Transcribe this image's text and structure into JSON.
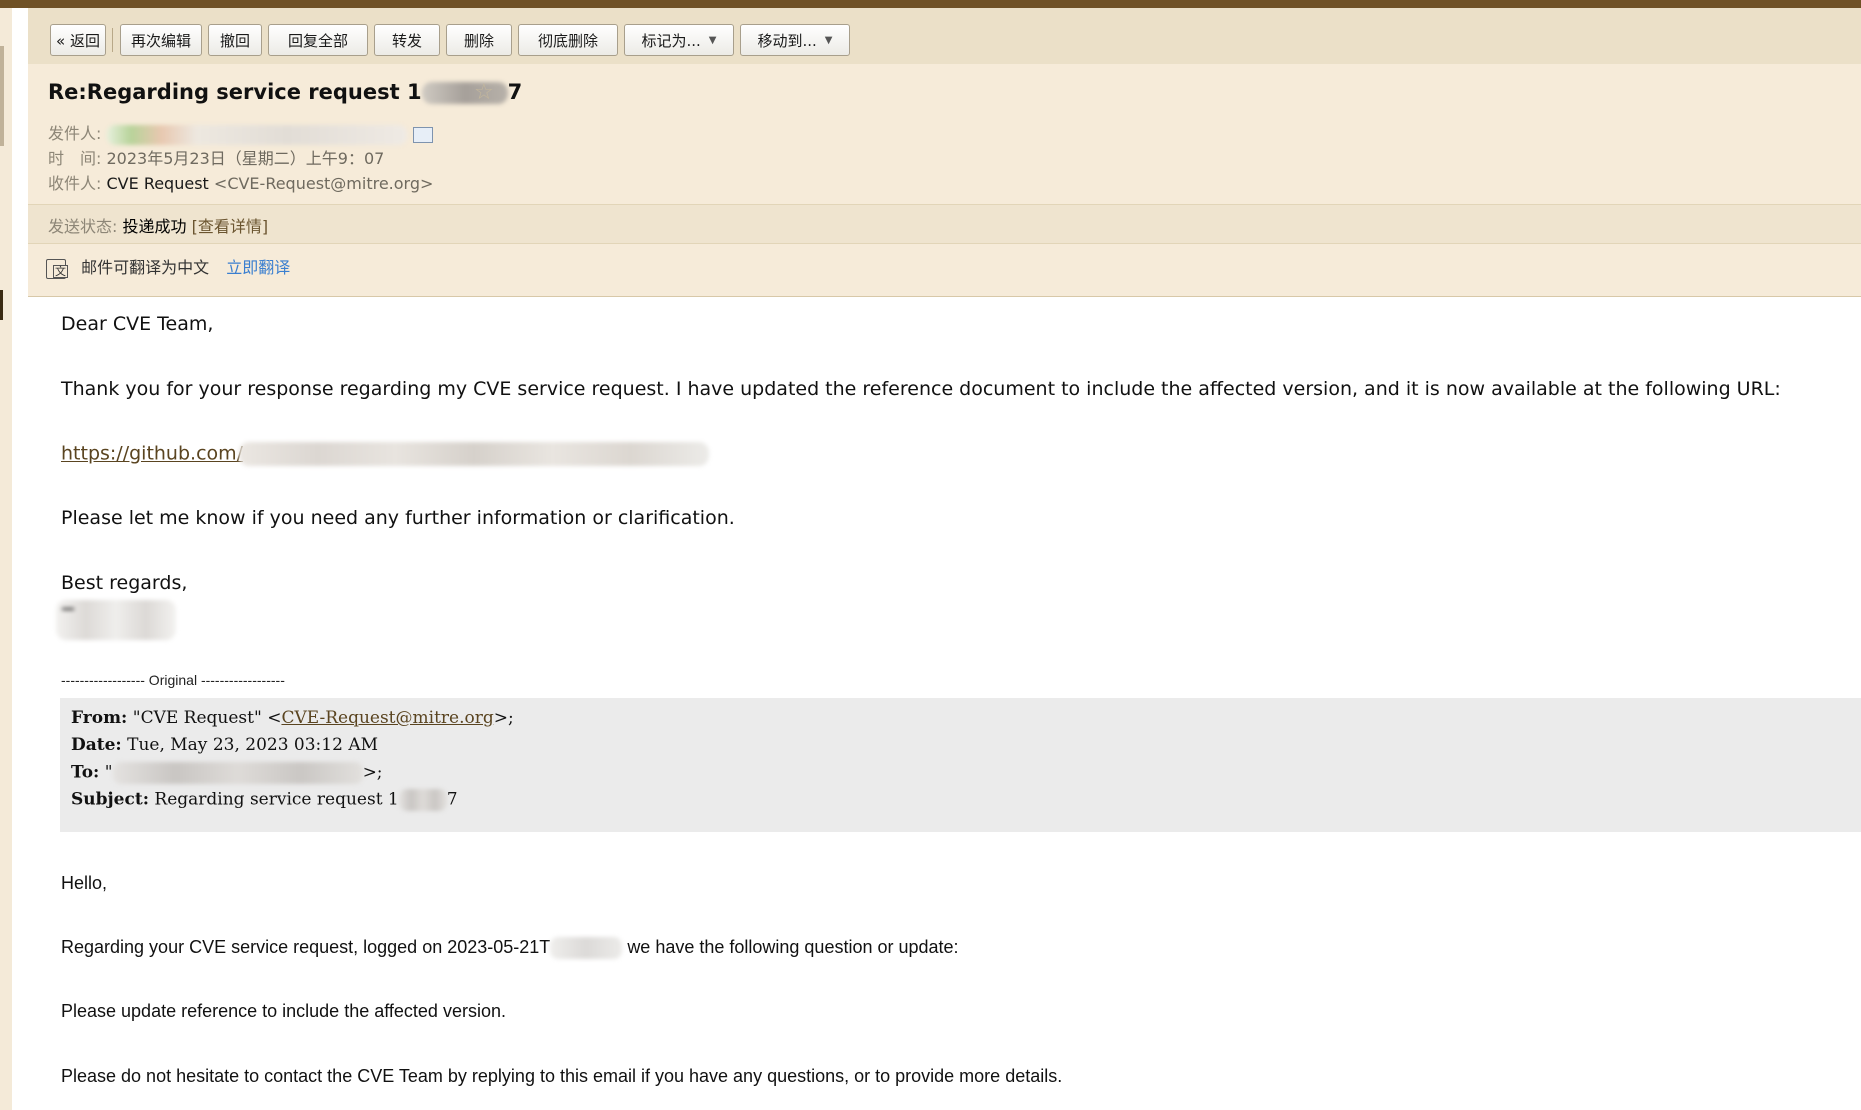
{
  "toolbar": {
    "back": "« 返回",
    "reedit": "再次编辑",
    "recall": "撤回",
    "reply_all": "回复全部",
    "forward": "转发",
    "delete": "删除",
    "delete_perm": "彻底删除",
    "mark_as": "标记为...",
    "move_to": "移动到..."
  },
  "header": {
    "subject_prefix": "Re:Regarding service request 1",
    "subject_suffix": "7",
    "from_label": "发件人:",
    "time_label": "时　间:",
    "time_value": "2023年5月23日（星期二）上午9：07",
    "to_label": "收件人:",
    "to_name": "CVE Request",
    "to_email": "<CVE-Request@mitre.org>",
    "status_label": "发送状态:",
    "status_value": "投递成功",
    "status_detail": "[查看详情]",
    "translate_text": "邮件可翻译为中文",
    "translate_link": "立即翻译"
  },
  "body": {
    "greeting": "Dear CVE Team,",
    "para1": "Thank you for your response regarding my CVE service request. I have updated the reference document to include the affected version, and it is now available at the following URL:",
    "url_visible": "https://github.com/",
    "para2": "Please let me know if you need any further information or clarification.",
    "closing": "Best regards,"
  },
  "original": {
    "separator": "------------------ Original ------------------",
    "from_label": "From:",
    "from_name": "\"CVE Request\" <",
    "from_email": "CVE-Request@mitre.org",
    "from_end": ">;",
    "date_label": "Date:",
    "date_value": "Tue, May 23, 2023 03:12 AM",
    "to_label": "To:",
    "to_start": "\"",
    "to_end": ">;",
    "subject_label": "Subject:",
    "subject_value": "Regarding service request 1",
    "subject_end": "7"
  },
  "reply": {
    "hello": "Hello,",
    "line1_start": "Regarding your CVE service request, logged on 2023-05-21T",
    "line1_end": "we have the following question or update:",
    "line2": "Please update reference to include the affected version.",
    "line3": "Please do not hesitate to contact the CVE Team by replying to this email if you have any questions, or to provide more details."
  }
}
